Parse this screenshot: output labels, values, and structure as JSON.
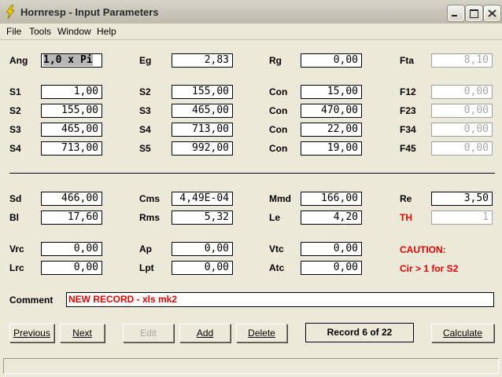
{
  "window": {
    "title": "Hornresp - Input Parameters"
  },
  "menu": [
    "File",
    "Tools",
    "Window",
    "Help"
  ],
  "fields": [
    {
      "label": "Ang",
      "value": "1,0 x Pi",
      "state": "selected"
    },
    {
      "label": "Eg",
      "value": "2,83"
    },
    {
      "label": "Rg",
      "value": "0,00"
    },
    {
      "label": "Fta",
      "value": "8,10",
      "state": "disabled"
    },
    {
      "label": "S1",
      "value": "1,00"
    },
    {
      "label": "S2",
      "value": "155,00"
    },
    {
      "label": "Con",
      "value": "15,00"
    },
    {
      "label": "F12",
      "value": "0,00",
      "state": "disabled"
    },
    {
      "label": "S2",
      "value": "155,00"
    },
    {
      "label": "S3",
      "value": "465,00"
    },
    {
      "label": "Con",
      "value": "470,00"
    },
    {
      "label": "F23",
      "value": "0,00",
      "state": "disabled"
    },
    {
      "label": "S3",
      "value": "465,00"
    },
    {
      "label": "S4",
      "value": "713,00"
    },
    {
      "label": "Con",
      "value": "22,00"
    },
    {
      "label": "F34",
      "value": "0,00",
      "state": "disabled"
    },
    {
      "label": "S4",
      "value": "713,00"
    },
    {
      "label": "S5",
      "value": "992,00"
    },
    {
      "label": "Con",
      "value": "19,00"
    },
    {
      "label": "F45",
      "value": "0,00",
      "state": "disabled"
    },
    {
      "label": "Sd",
      "value": "466,00"
    },
    {
      "label": "Cms",
      "value": "4,49E-04"
    },
    {
      "label": "Mmd",
      "value": "166,00"
    },
    {
      "label": "Re",
      "value": "3,50"
    },
    {
      "label": "Bl",
      "value": "17,60"
    },
    {
      "label": "Rms",
      "value": "5,32"
    },
    {
      "label": "Le",
      "value": "4,20"
    },
    {
      "label": "TH",
      "value": "1",
      "state": "disabled",
      "label_color": "red"
    },
    {
      "label": "Vrc",
      "value": "0,00"
    },
    {
      "label": "Ap",
      "value": "0,00"
    },
    {
      "label": "Vtc",
      "value": "0,00"
    },
    {
      "label": "Lrc",
      "value": "0,00"
    },
    {
      "label": "Lpt",
      "value": "0,00"
    },
    {
      "label": "Atc",
      "value": "0,00"
    }
  ],
  "caution": {
    "title": "CAUTION:",
    "message": "Cir > 1 for S2",
    "color": "#e00000"
  },
  "comment": {
    "label": "Comment",
    "value": "NEW RECORD - xls mk2"
  },
  "buttons": {
    "previous": "Previous",
    "next": "Next",
    "edit": "Edit",
    "add": "Add",
    "delete": "Delete",
    "calculate": "Calculate"
  },
  "record_label": "Record 6 of 22",
  "icons": {
    "app": "lightning-bolt-icon",
    "min": "minimize-icon",
    "max": "maximize-icon",
    "close": "close-icon"
  }
}
